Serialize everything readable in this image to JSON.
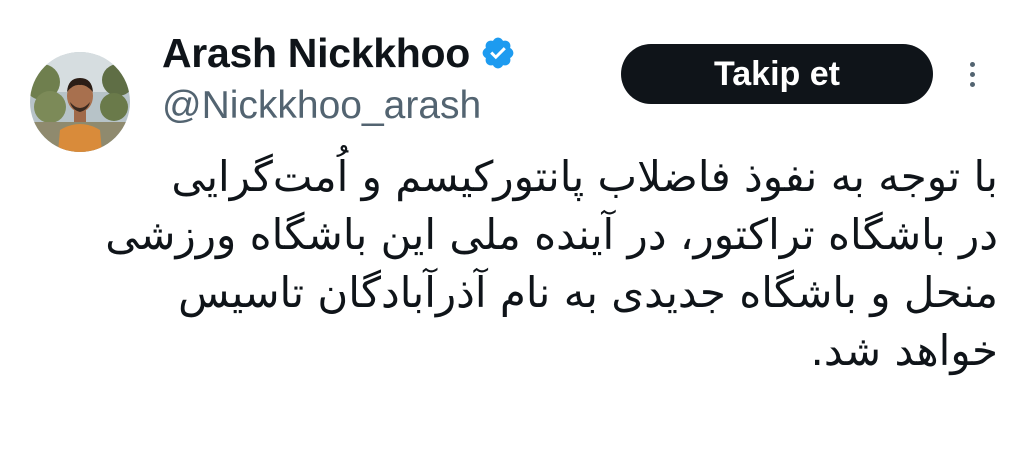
{
  "user": {
    "display_name": "Arash Nickkhoo",
    "handle": "@Nickkhoo_arash",
    "verified_icon": "verified-badge-icon",
    "verified_color": "#1d9bf0"
  },
  "actions": {
    "follow_label": "Takip et",
    "more_icon": "more-vertical-icon"
  },
  "tweet": {
    "lines": [
      "با توجه به نفوذ فاضلاب پانتورکیسم و اُمت‌گرایی",
      "در باشگاه تراکتور، در آینده ملی این باشگاه ورزشی",
      "منحل و باشگاه جدیدی به نام آذرآبادگان تاسیس",
      "خواهد شد."
    ]
  },
  "colors": {
    "text_primary": "#0f1419",
    "text_secondary": "#536471",
    "button_bg": "#0f1419",
    "button_text": "#ffffff"
  }
}
